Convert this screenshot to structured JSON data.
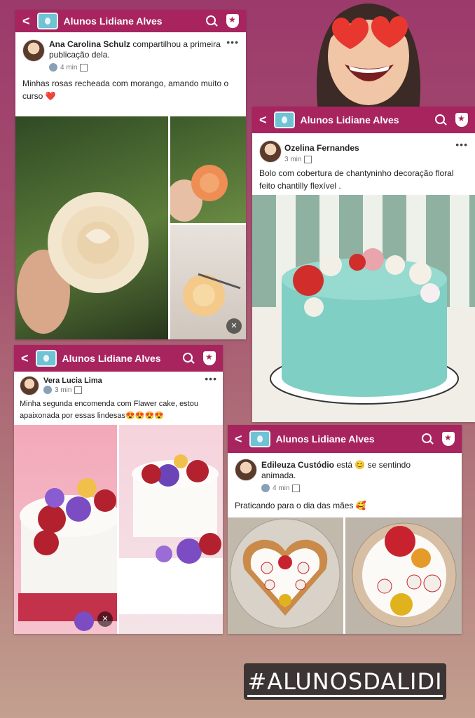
{
  "group_name": "Alunos Lidiane Alves",
  "post1": {
    "author": "Ana Carolina Schulz",
    "action": "compartilhou a primeira publicação dela.",
    "time": "4 min",
    "text": "Minhas rosas recheada com morango, amando muito o curso ❤️"
  },
  "post2": {
    "author": "Ozelina Fernandes",
    "time": "3 min",
    "text": "Bolo com  cobertura de chantyninho decoração floral feito chantilly flexível ."
  },
  "post3": {
    "author": "Vera Lucia Lima",
    "time": "3 min",
    "text": "Minha segunda encomenda com Flawer cake, estou apaixonada por essas lindesas😍😍😍😍"
  },
  "post4": {
    "author": "Edileuza Custódio",
    "status": "está 😊 se sentindo animada.",
    "time": "4 min",
    "text": "Praticando para o dia das mães 🥰"
  },
  "hashtag": "#ALUNOSDALIDI",
  "icons": [
    "back-arrow-icon",
    "group-icon",
    "search-icon",
    "shield-star-icon",
    "more-icon",
    "volume-off-icon",
    "audience-icon",
    "calendar-icon"
  ]
}
